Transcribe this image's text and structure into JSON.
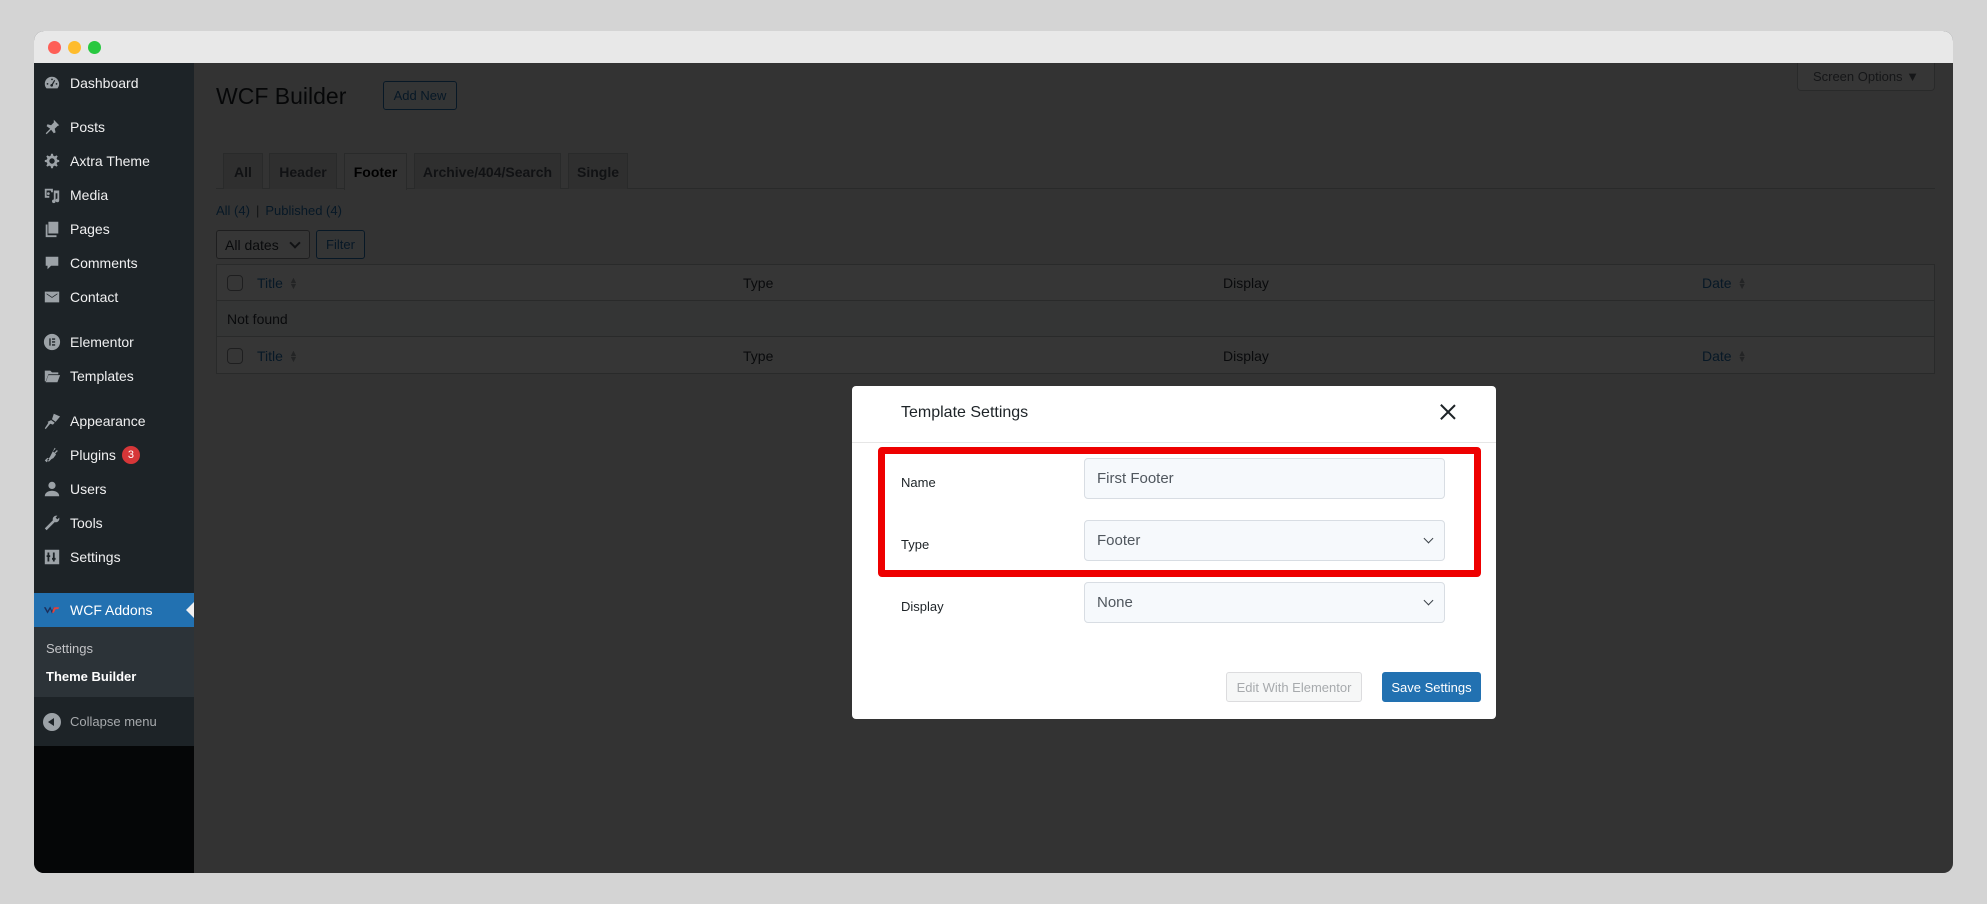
{
  "window": {
    "traffic_lights": [
      "close",
      "minimize",
      "zoom"
    ]
  },
  "sidebar": {
    "items": [
      {
        "label": "Dashboard",
        "icon": "dashboard-icon"
      },
      {
        "label": "Posts",
        "icon": "pin-icon"
      },
      {
        "label": "Axtra Theme",
        "icon": "gear-icon"
      },
      {
        "label": "Media",
        "icon": "media-icon"
      },
      {
        "label": "Pages",
        "icon": "pages-icon"
      },
      {
        "label": "Comments",
        "icon": "comment-icon"
      },
      {
        "label": "Contact",
        "icon": "mail-icon"
      },
      {
        "label": "Elementor",
        "icon": "elementor-icon"
      },
      {
        "label": "Templates",
        "icon": "folder-icon"
      },
      {
        "label": "Appearance",
        "icon": "brush-icon"
      },
      {
        "label": "Plugins",
        "icon": "plug-icon",
        "badge": "3"
      },
      {
        "label": "Users",
        "icon": "user-icon"
      },
      {
        "label": "Tools",
        "icon": "wrench-icon"
      },
      {
        "label": "Settings",
        "icon": "sliders-icon"
      },
      {
        "label": "WCF Addons",
        "icon": "wcf-logo-icon",
        "active": true
      }
    ],
    "submenu": [
      {
        "label": "Settings"
      },
      {
        "label": "Theme Builder",
        "current": true
      }
    ],
    "collapse_label": "Collapse menu"
  },
  "main": {
    "title": "WCF Builder",
    "add_new_label": "Add New",
    "screen_options_label": "Screen Options ▼",
    "tabs": [
      {
        "label": "All"
      },
      {
        "label": "Header"
      },
      {
        "label": "Footer",
        "active": true
      },
      {
        "label": "Archive/404/Search"
      },
      {
        "label": "Single"
      }
    ],
    "status_links": {
      "all": "All (4)",
      "separator": "|",
      "published": "Published (4)"
    },
    "date_filter": {
      "selected": "All dates"
    },
    "filter_label": "Filter",
    "table": {
      "columns": [
        "Title",
        "Type",
        "Display",
        "Date"
      ],
      "empty_message": "Not found"
    }
  },
  "modal": {
    "title": "Template Settings",
    "fields": {
      "name": {
        "label": "Name",
        "value": "First Footer"
      },
      "type": {
        "label": "Type",
        "value": "Footer"
      },
      "display": {
        "label": "Display",
        "value": "None"
      }
    },
    "edit_button_label": "Edit With Elementor",
    "save_button_label": "Save Settings"
  },
  "colors": {
    "accent": "#2271b1",
    "highlight": "#ee0000",
    "badge": "#d63638",
    "sidebar_bg": "#1d2327"
  }
}
